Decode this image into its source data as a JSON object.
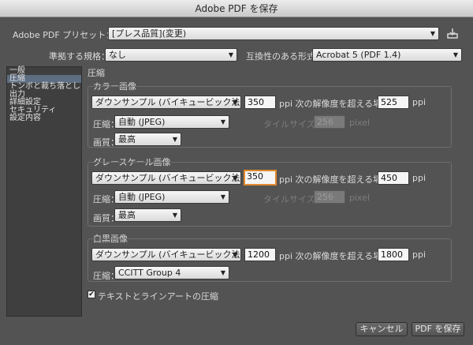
{
  "window": {
    "title": "Adobe PDF を保存"
  },
  "preset": {
    "label": "Adobe PDF プリセット：",
    "value": "[プレス品質](変更)"
  },
  "standard": {
    "label": "準拠する規格：",
    "value": "なし"
  },
  "compat": {
    "label": "互換性のある形式：",
    "value": "Acrobat 5 (PDF 1.4)"
  },
  "sidebar": {
    "items": [
      {
        "label": "一般"
      },
      {
        "label": "圧縮"
      },
      {
        "label": "トンボと裁ち落とし"
      },
      {
        "label": "出力"
      },
      {
        "label": "詳細設定"
      },
      {
        "label": "セキュリティ"
      },
      {
        "label": "設定内容"
      }
    ]
  },
  "section": {
    "title": "圧縮"
  },
  "color": {
    "title": "カラー画像",
    "method": "ダウンサンプル (バイキュービック法)",
    "ppi_value": "350",
    "ppi_label": "ppi 次の解像度を超える場合",
    "threshold": "525",
    "threshold_unit": "ppi",
    "compress_label": "圧縮：",
    "compress_value": "自動 (JPEG)",
    "tile_label": "タイルサイズ：",
    "tile_value": "256",
    "tile_unit": "pixel",
    "quality_label": "画質：",
    "quality_value": "最高"
  },
  "gray": {
    "title": "グレースケール画像",
    "method": "ダウンサンプル (バイキュービック法)",
    "ppi_value": "350",
    "ppi_label": "ppi 次の解像度を超える場合",
    "threshold": "450",
    "threshold_unit": "ppi",
    "compress_label": "圧縮：",
    "compress_value": "自動 (JPEG)",
    "tile_label": "タイルサイズ：",
    "tile_value": "256",
    "tile_unit": "pixel",
    "quality_label": "画質：",
    "quality_value": "最高"
  },
  "mono": {
    "title": "白黒画像",
    "method": "ダウンサンプル (バイキュービック法)",
    "ppi_value": "1200",
    "ppi_label": "ppi 次の解像度を超える場合",
    "threshold": "1800",
    "threshold_unit": "ppi",
    "compress_label": "圧縮：",
    "compress_value": "CCITT Group 4"
  },
  "text_art": {
    "label": "テキストとラインアートの圧縮",
    "checked": true
  },
  "buttons": {
    "cancel": "キャンセル",
    "save": "PDF を保存"
  }
}
